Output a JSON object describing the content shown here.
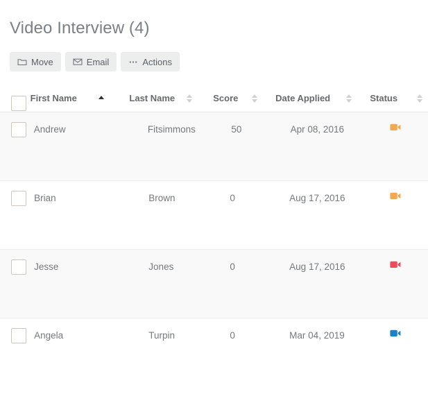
{
  "page": {
    "title": "Video Interview (4)"
  },
  "toolbar": {
    "buttons": [
      {
        "label": "Move",
        "icon": "folder-icon"
      },
      {
        "label": "Email",
        "icon": "envelope-icon"
      },
      {
        "label": "Actions",
        "icon": "ellipsis-icon"
      }
    ]
  },
  "table": {
    "columns": [
      {
        "key": "first_name",
        "label": "First Name",
        "sort": "asc"
      },
      {
        "key": "last_name",
        "label": "Last Name",
        "sort": "none"
      },
      {
        "key": "score",
        "label": "Score",
        "sort": "none"
      },
      {
        "key": "date_applied",
        "label": "Date Applied",
        "sort": "none"
      },
      {
        "key": "status",
        "label": "Status",
        "sort": "none"
      }
    ],
    "rows": [
      {
        "first_name": "Andrew",
        "last_name": "Fitsimmons",
        "score": "50",
        "date_applied": "Apr 08, 2016",
        "status_icon": "video-camera-icon",
        "status_color": "#f5a94e",
        "checked": false
      },
      {
        "first_name": "Brian",
        "last_name": "Brown",
        "score": "0",
        "date_applied": "Aug 17, 2016",
        "status_icon": "video-camera-icon",
        "status_color": "#f5a94e",
        "checked": false
      },
      {
        "first_name": "Jesse",
        "last_name": "Jones",
        "score": "0",
        "date_applied": "Aug 17, 2016",
        "status_icon": "video-camera-icon",
        "status_color": "#ef4a5e",
        "checked": false
      },
      {
        "first_name": "Angela",
        "last_name": "Turpin",
        "score": "0",
        "date_applied": "Mar 04, 2019",
        "status_icon": "video-camera-icon",
        "status_color": "#1c81c4",
        "checked": false
      }
    ]
  },
  "colors": {
    "title_text": "#7b8085",
    "button_bg": "#eceded",
    "row_alt_bg": "#f9f9f9",
    "border": "#ededed",
    "checkbox_border": "#cdc8bf",
    "sort_inactive": "#cfd1d2",
    "sort_active": "#2f3133"
  }
}
